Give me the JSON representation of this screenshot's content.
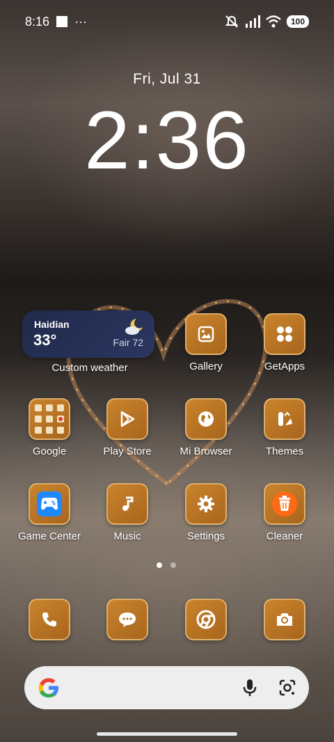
{
  "status": {
    "time": "8:16",
    "more": "···",
    "battery": "100"
  },
  "lock": {
    "date": "Fri, Jul 31",
    "time": "2:36"
  },
  "weather": {
    "city": "Haidian",
    "temp": "33°",
    "condition": "Fair 72",
    "label": "Custom weather",
    "bg": "#1f2a4a"
  },
  "apps": [
    {
      "label": "Gallery",
      "icon": "gallery-icon"
    },
    {
      "label": "GetApps",
      "icon": "getapps-icon"
    },
    {
      "label": "Google",
      "icon": "folder-icon"
    },
    {
      "label": "Play Store",
      "icon": "play-store-icon"
    },
    {
      "label": "Mi Browser",
      "icon": "globe-icon"
    },
    {
      "label": "Themes",
      "icon": "themes-icon"
    },
    {
      "label": "Game Center",
      "icon": "gamepad-icon"
    },
    {
      "label": "Music",
      "icon": "music-note-icon"
    },
    {
      "label": "Settings",
      "icon": "gear-icon"
    },
    {
      "label": "Cleaner",
      "icon": "trash-icon"
    }
  ],
  "dock": [
    {
      "icon": "phone-icon"
    },
    {
      "icon": "messages-icon"
    },
    {
      "icon": "chrome-icon"
    },
    {
      "icon": "camera-icon"
    }
  ],
  "pages": {
    "count": 2,
    "current": 1
  },
  "colors": {
    "tile": "#b8731f",
    "cleaner": "#ff6a14",
    "game": "#1e88ff"
  }
}
